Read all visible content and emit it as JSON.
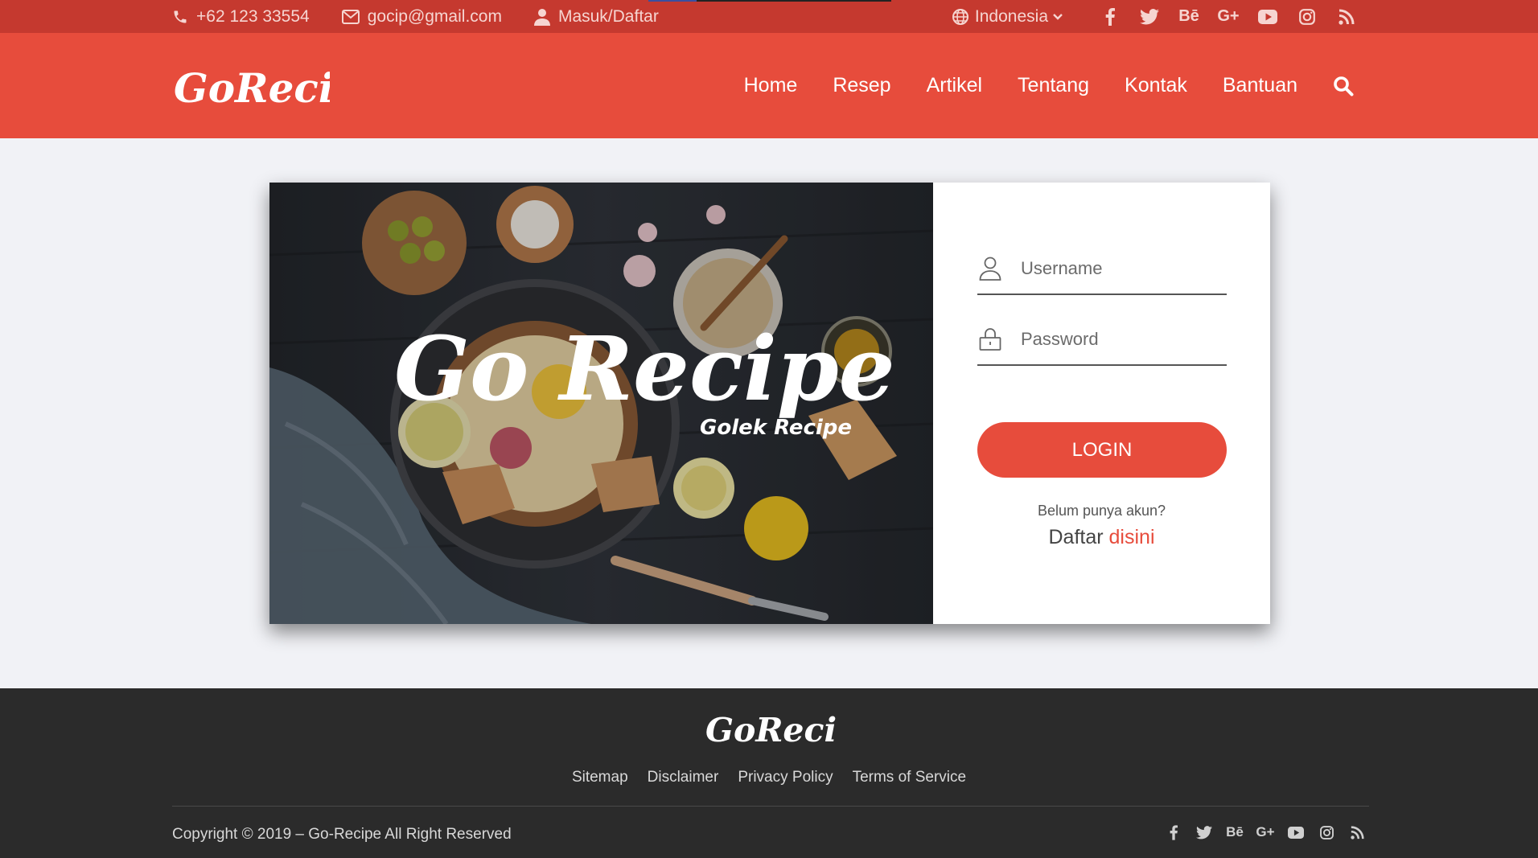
{
  "topbar": {
    "phone": "+62 123 33554",
    "email": "gocip@gmail.com",
    "account": "Masuk/Daftar",
    "language": "Indonesia",
    "social_behance": "Bē",
    "social_gplus": "G+"
  },
  "brand": {
    "logo_text": "GoRecipe"
  },
  "nav": {
    "items": [
      "Home",
      "Resep",
      "Artikel",
      "Tentang",
      "Kontak",
      "Bantuan"
    ]
  },
  "hero": {
    "title": "Go Recipe",
    "subtitle": "Golek Recipe"
  },
  "login": {
    "username_placeholder": "Username",
    "password_placeholder": "Password",
    "button_label": "LOGIN",
    "no_account_text": "Belum punya akun?",
    "register_prefix": "Daftar",
    "register_link": "disini"
  },
  "footer": {
    "logo_text": "GoRecipe",
    "links": [
      "Sitemap",
      "Disclaimer",
      "Privacy Policy",
      "Terms of Service"
    ],
    "copyright": "Copyright © 2019 – Go-Recipe All Right Reserved"
  },
  "colors": {
    "brand_red": "#e74c3c",
    "topbar_red": "#c5392f",
    "footer_dark": "#2b2b2b"
  }
}
